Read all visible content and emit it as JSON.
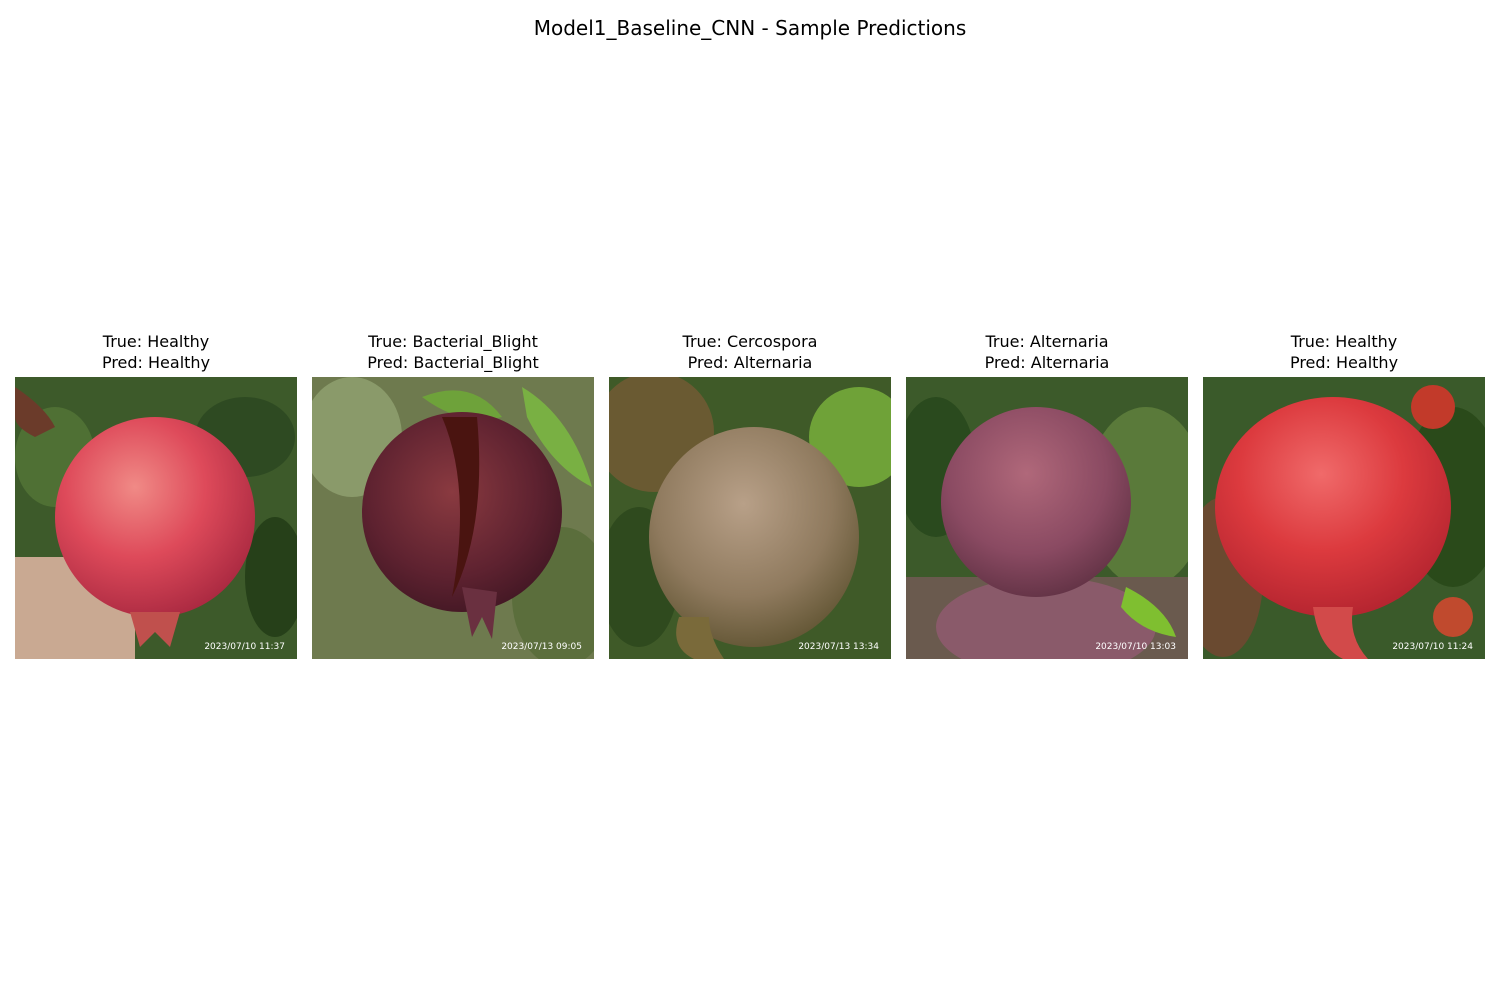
{
  "figure": {
    "title": "Model1_Baseline_CNN - Sample Predictions"
  },
  "samples": [
    {
      "true_label": "True: Healthy",
      "pred_label": "Pred: Healthy",
      "timestamp": "2023/07/10 11:37"
    },
    {
      "true_label": "True: Bacterial_Blight",
      "pred_label": "Pred: Bacterial_Blight",
      "timestamp": "2023/07/13 09:05"
    },
    {
      "true_label": "True: Cercospora",
      "pred_label": "Pred: Alternaria",
      "timestamp": "2023/07/13 13:34"
    },
    {
      "true_label": "True: Alternaria",
      "pred_label": "Pred: Alternaria",
      "timestamp": "2023/07/10 13:03"
    },
    {
      "true_label": "True: Healthy",
      "pred_label": "Pred: Healthy",
      "timestamp": "2023/07/10 11:24"
    }
  ]
}
